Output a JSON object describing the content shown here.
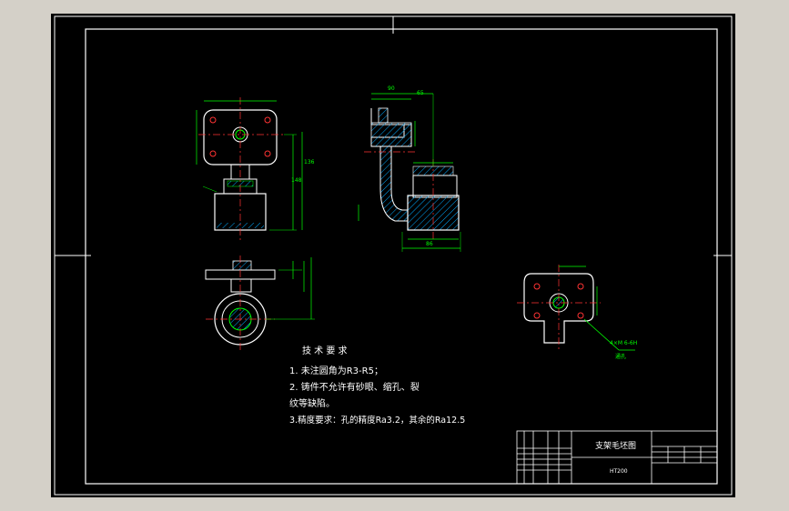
{
  "colors": {
    "background": "#000000",
    "outline": "#ffffff",
    "dimension": "#00ff00",
    "center_line": "#ff3333",
    "hatch": "#00aaff",
    "window_frame": "#d4d0c8"
  },
  "views": {
    "section_dim_labels": [
      "90",
      "65"
    ],
    "section_dim_labels_2": [
      "148",
      "136"
    ],
    "section_dim_label_bottom": "86"
  },
  "tech_requirements": {
    "heading": "技 术 要 求",
    "line1": "1. 未注圆角为R3-R5；",
    "line2": "2. 铸件不允许有砂眼、缩孔、裂",
    "line3": "纹等缺陷。",
    "line4": "3.精度要求：孔的精度Ra3.2，其余的Ra12.5"
  },
  "title_block": {
    "drawing_name": "支架毛坯图",
    "material": "HT200"
  },
  "right_view": {
    "callout_line1": "4×M 6-6H",
    "callout_line2": "通孔"
  }
}
